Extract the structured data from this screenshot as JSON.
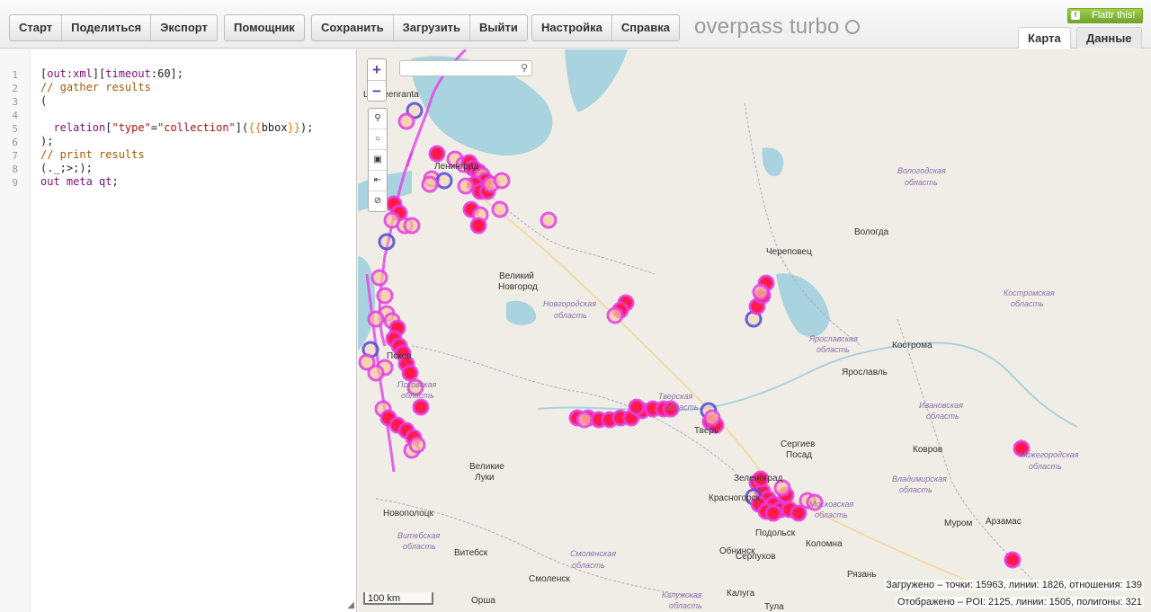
{
  "toolbar": {
    "group1": [
      "Старт",
      "Поделиться",
      "Экспорт"
    ],
    "group2": [
      "Помощник"
    ],
    "group3": [
      "Сохранить",
      "Загрузить",
      "Выйти"
    ],
    "group4": [
      "Настройка",
      "Справка"
    ],
    "brand": "overpass turbo",
    "flattr": "Flattr this!"
  },
  "tabs": {
    "map": "Карта",
    "data": "Данные"
  },
  "editor": {
    "line_numbers": [
      "1",
      "2",
      "3",
      "4",
      "5",
      "6",
      "7",
      "8",
      "9"
    ]
  },
  "map": {
    "cities": [
      {
        "name": "Lappeenranta"
      },
      {
        "name": "Ленинград"
      },
      {
        "name": "Вологда"
      },
      {
        "name": "Череповец"
      },
      {
        "name": "Великий"
      },
      {
        "name": "Новгород"
      },
      {
        "name": "Кострома"
      },
      {
        "name": "Ярославль"
      },
      {
        "name": "Тверь"
      },
      {
        "name": "Сергиев"
      },
      {
        "name": "Посад"
      },
      {
        "name": "Ковров"
      },
      {
        "name": "Великие"
      },
      {
        "name": "Луки"
      },
      {
        "name": "Зеленоград"
      },
      {
        "name": "Красногорск"
      },
      {
        "name": "Новополоцк"
      },
      {
        "name": "Витебск"
      },
      {
        "name": "Смоленск"
      },
      {
        "name": "Обнинск"
      },
      {
        "name": "Подольск"
      },
      {
        "name": "Коломна"
      },
      {
        "name": "Серпухов"
      },
      {
        "name": "Муром"
      },
      {
        "name": "Арзамас"
      },
      {
        "name": "Рязань"
      },
      {
        "name": "Орша"
      },
      {
        "name": "Калуга"
      },
      {
        "name": "Тула"
      },
      {
        "name": "Псков"
      }
    ],
    "regions": [
      {
        "name": "Вологодская"
      },
      {
        "name": "область"
      },
      {
        "name": "Новгородская"
      },
      {
        "name": "область"
      },
      {
        "name": "Костромская"
      },
      {
        "name": "область"
      },
      {
        "name": "Ярославская"
      },
      {
        "name": "область"
      },
      {
        "name": "Ивановская"
      },
      {
        "name": "область"
      },
      {
        "name": "Тверская"
      },
      {
        "name": "область"
      },
      {
        "name": "Псковская"
      },
      {
        "name": "область"
      },
      {
        "name": "Владимирская"
      },
      {
        "name": "область"
      },
      {
        "name": "Московская"
      },
      {
        "name": "область"
      },
      {
        "name": "Нижегородская"
      },
      {
        "name": "область"
      },
      {
        "name": "Витебская"
      },
      {
        "name": "область"
      },
      {
        "name": "Смоленская"
      },
      {
        "name": "область"
      },
      {
        "name": "Калужская"
      },
      {
        "name": "область"
      }
    ],
    "scale": "100 km",
    "stats_loaded": "Загружено – точки: 15963, линии: 1826, отношения: 139",
    "stats_shown": "Отображено – POI: 2125, линии: 1505, полигоны: 321",
    "colors": {
      "marker_fill": "#ff1a4a",
      "marker_stroke": "#e23ee8",
      "marker_outline_blue": "#4a4ad8",
      "water": "#a9d3df"
    }
  }
}
